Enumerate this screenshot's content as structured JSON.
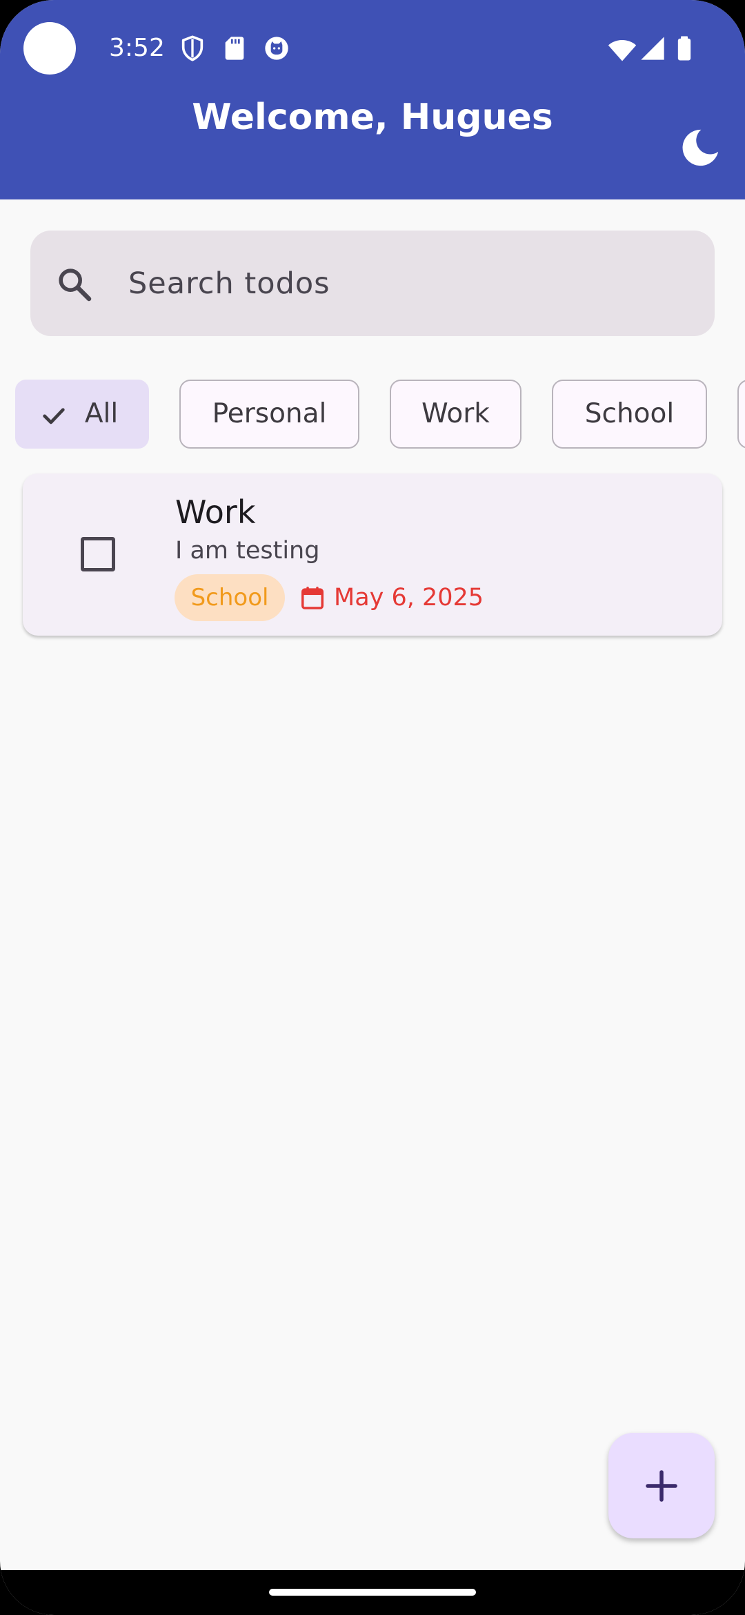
{
  "status_bar": {
    "time": "3:52",
    "left_icons": [
      "shield-icon",
      "sd-card-icon",
      "cat-icon"
    ],
    "right_icons": [
      "wifi-icon",
      "cell-signal-icon",
      "battery-icon"
    ]
  },
  "app_bar": {
    "title": "Welcome, Hugues",
    "background": "#3F51B5",
    "action_icon": "moon-icon"
  },
  "search": {
    "placeholder": "Search todos",
    "value": ""
  },
  "filters": {
    "selected": "All",
    "chips": [
      {
        "label": "All",
        "selected": true
      },
      {
        "label": "Personal",
        "selected": false
      },
      {
        "label": "Work",
        "selected": false
      },
      {
        "label": "School",
        "selected": false
      }
    ]
  },
  "todos": [
    {
      "title": "Work",
      "description": "I am testing",
      "completed": false,
      "category": "School",
      "category_color": "#F19A1C",
      "due_date": "May 6, 2025",
      "due_color": "#E53935"
    }
  ],
  "fab": {
    "icon": "plus-icon",
    "background": "#EADDFF"
  }
}
